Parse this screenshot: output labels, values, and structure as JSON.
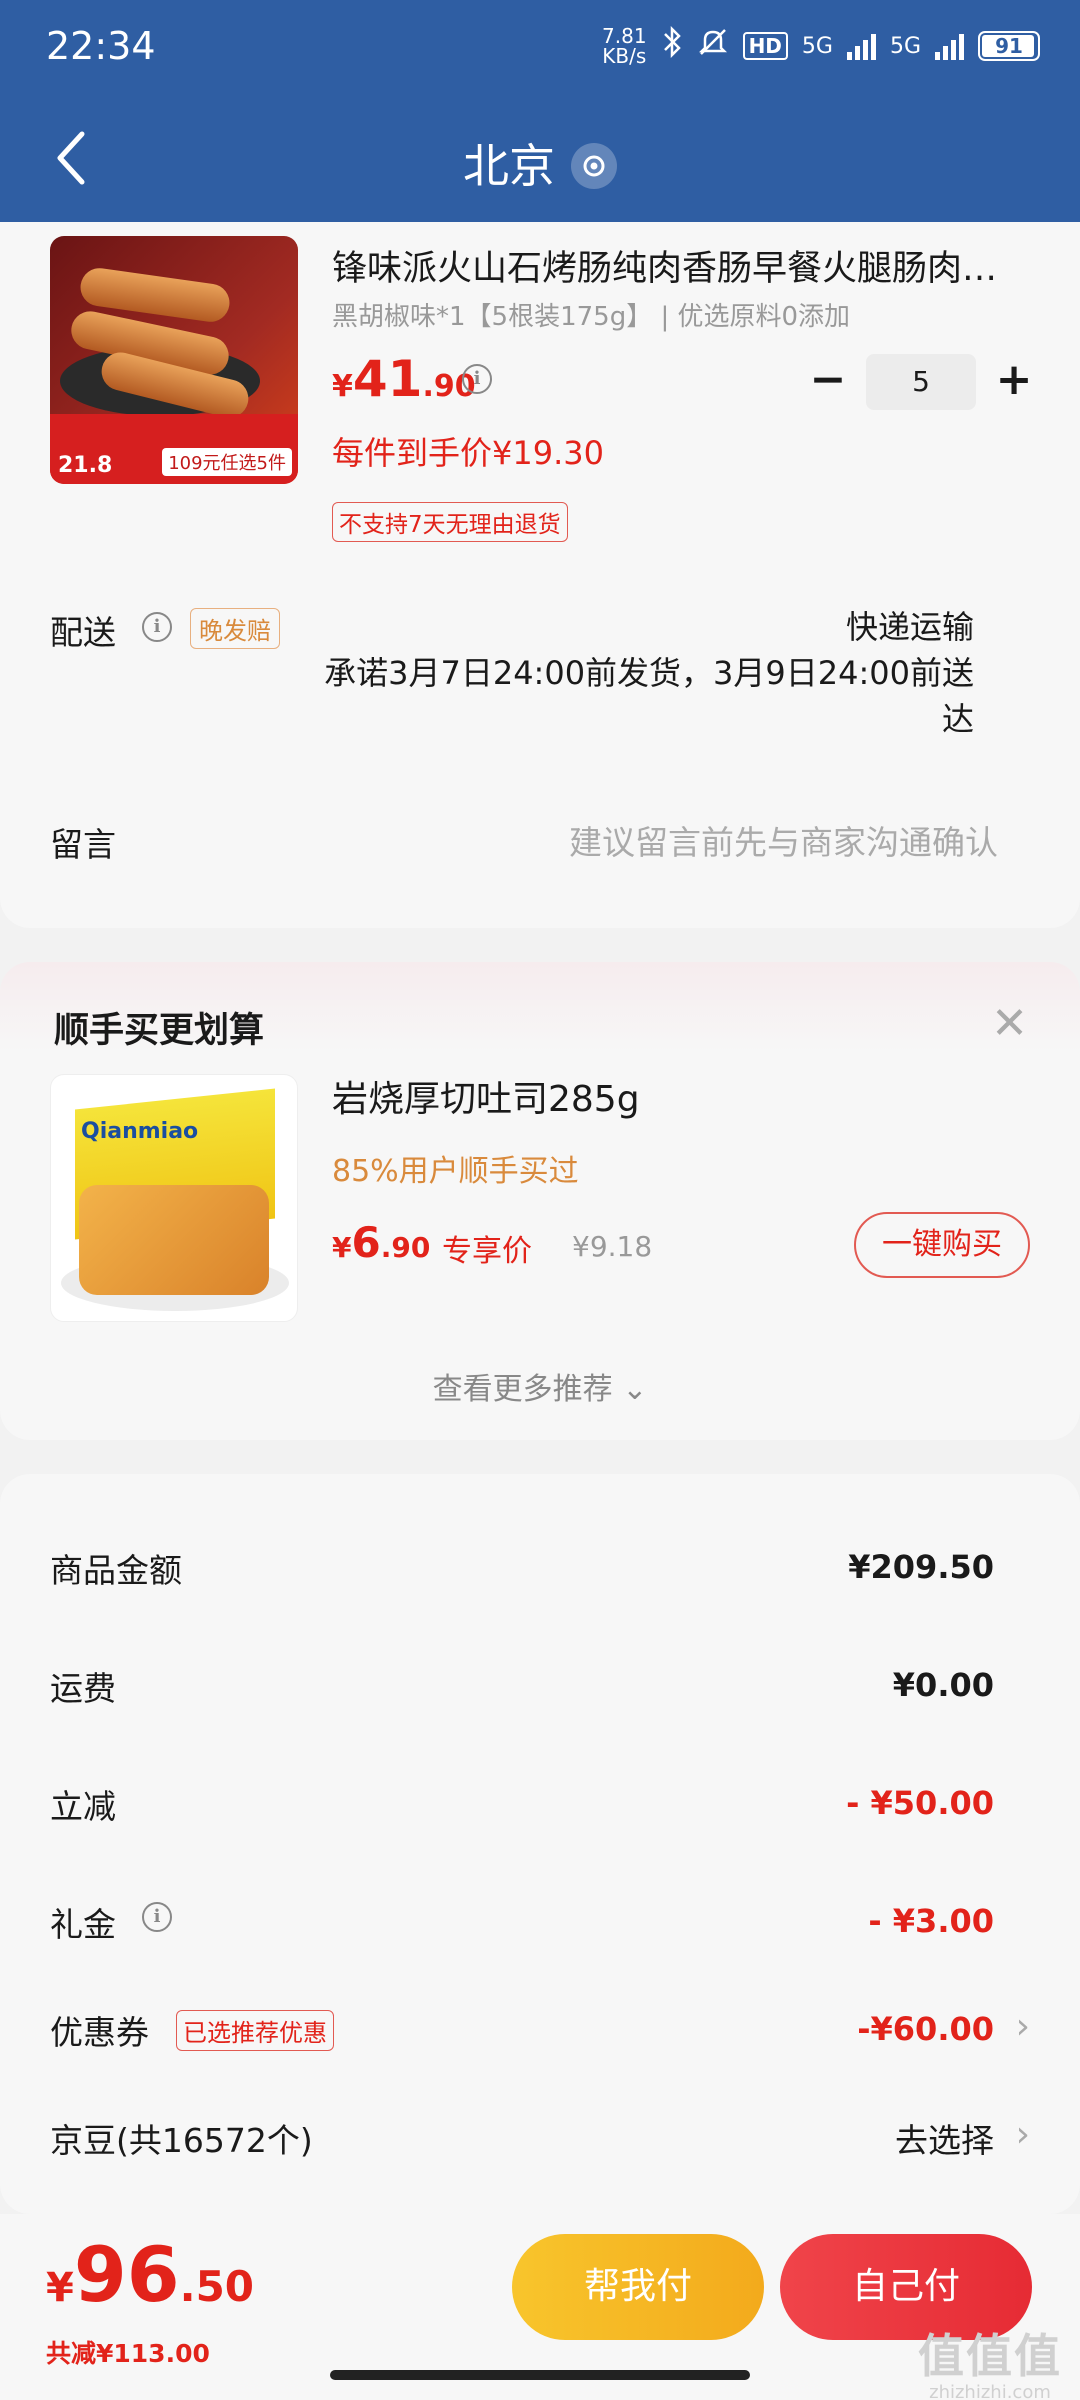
{
  "status_bar": {
    "time": "22:34",
    "net_speed_value": "7.81",
    "net_speed_unit": "KB/s",
    "hd_label": "HD",
    "signal1_label": "5G",
    "signal2_label": "5G",
    "battery_level": "91"
  },
  "header": {
    "title": "北京"
  },
  "product": {
    "title": "锋味派火山石烤肠纯肉香肠早餐火腿肠肉…",
    "spec": "黑胡椒味*1【5根装175g】 | 优选原料0添加",
    "price_currency": "¥",
    "price_int": "41",
    "price_dec": ".90",
    "quantity": "5",
    "unit_price": "每件到手价¥19.30",
    "return_tag": "不支持7天无理由退货",
    "image_price": "21.8",
    "image_promo": "109元任选5件"
  },
  "delivery": {
    "label": "配送",
    "late_tag": "晚发赔",
    "method": "快递运输",
    "promise": "承诺3月7日24:00前发货，3月9日24:00前送达"
  },
  "remark": {
    "label": "留言",
    "placeholder": "建议留言前先与商家沟通确认"
  },
  "bundle": {
    "title": "顺手买更划算",
    "item_name": "岩烧厚切吐司285g",
    "social_proof": "85%用户顺手买过",
    "price_currency": "¥",
    "price_int": "6",
    "price_dec": ".90",
    "exclusive_label": "专享价",
    "original_price": "¥9.18",
    "buy_button": "一键购买",
    "image_brand": "Qianmiao",
    "more": "查看更多推荐 ⌄"
  },
  "summary": {
    "goods_label": "商品金额",
    "goods_value": "¥209.50",
    "shipping_label": "运费",
    "shipping_value": "¥0.00",
    "discount_label": "立减",
    "discount_value": "- ¥50.00",
    "gift_label": "礼金",
    "gift_value": "- ¥3.00",
    "coupon_label": "优惠券",
    "coupon_tag": "已选推荐优惠",
    "coupon_value": "-¥60.00",
    "jingdou_label": "京豆(共16572个)",
    "jingdou_action": "去选择"
  },
  "footer": {
    "total_currency": "¥",
    "total_int": "96",
    "total_dec": ".50",
    "saved": "共减¥113.00",
    "help_pay": "帮我付",
    "self_pay": "自己付"
  },
  "watermark": {
    "logo": "值值值",
    "url": "zhizhizhi.com"
  },
  "colors": {
    "header_bg": "#2f5ea3",
    "accent_red": "#e2231a",
    "help_pay_yellow": "#f8c52c",
    "self_pay_red": "#e62b34",
    "tag_orange": "#d98a3c"
  }
}
